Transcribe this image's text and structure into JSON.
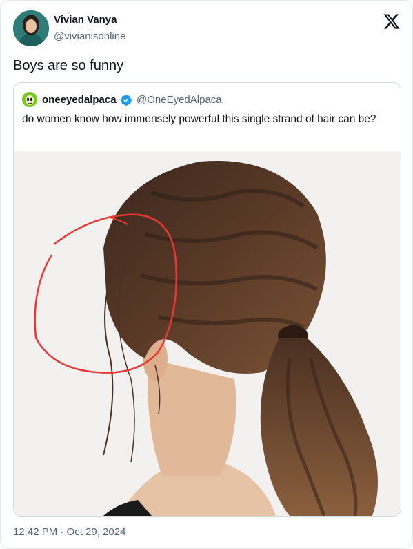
{
  "tweet": {
    "author": {
      "display_name": "Vivian Vanya",
      "handle": "@vivianisonline",
      "avatar_icon": "profile-photo"
    },
    "text": "Boys are so funny",
    "timestamp": "12:42 PM · Oct 29, 2024",
    "platform_icon": "x-logo-icon"
  },
  "quoted_tweet": {
    "author": {
      "display_name": "oneeyedalpaca",
      "handle": "@OneEyedAlpaca",
      "verified": true,
      "verified_icon": "verified-badge-icon",
      "avatar_icon": "alien-face-avatar"
    },
    "text": "do women know how immensely powerful this single strand of hair can be?",
    "image_icon": "hairstyle-photo-with-red-circle"
  },
  "colors": {
    "text_primary": "#0f1419",
    "text_secondary": "#536471",
    "verified_blue": "#1d9bf0",
    "border": "#cfd9de",
    "circle_annotation": "#e53935"
  }
}
